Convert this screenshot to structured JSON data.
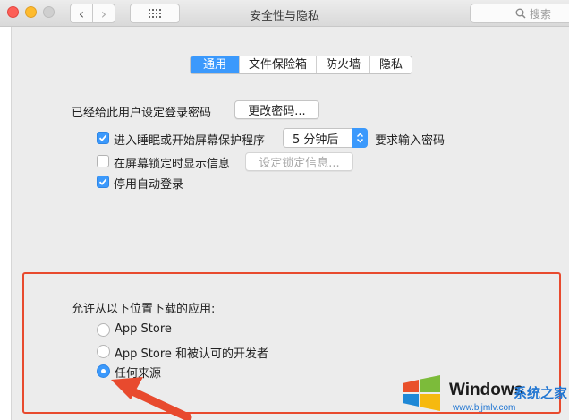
{
  "window": {
    "title": "安全性与隐私",
    "search_placeholder": "搜索"
  },
  "tabs": [
    {
      "label": "通用",
      "active": true
    },
    {
      "label": "文件保险箱",
      "active": false
    },
    {
      "label": "防火墙",
      "active": false
    },
    {
      "label": "隐私",
      "active": false
    }
  ],
  "general": {
    "password_label": "已经给此用户设定登录密码",
    "change_password_button": "更改密码...",
    "sleep_checkbox_label": "进入睡眠或开始屏幕保护程序",
    "sleep_checkbox_checked": true,
    "sleep_delay_value": "5 分钟后",
    "require_password_label": "要求输入密码",
    "lock_message_label": "在屏幕锁定时显示信息",
    "lock_message_checked": false,
    "set_lock_message_button": "设定锁定信息...",
    "disable_autologin_label": "停用自动登录",
    "disable_autologin_checked": true
  },
  "download_apps": {
    "heading": "允许从以下位置下载的应用:",
    "options": [
      {
        "label": "App Store",
        "selected": false
      },
      {
        "label": "App Store 和被认可的开发者",
        "selected": false
      },
      {
        "label": "任何来源",
        "selected": true
      }
    ]
  },
  "watermark": {
    "brand": "Windows",
    "brand_suffix": "系统之家",
    "url": "www.bjjmlv.com"
  },
  "colors": {
    "accent": "#3b99fc",
    "highlight": "#e84a2e"
  }
}
